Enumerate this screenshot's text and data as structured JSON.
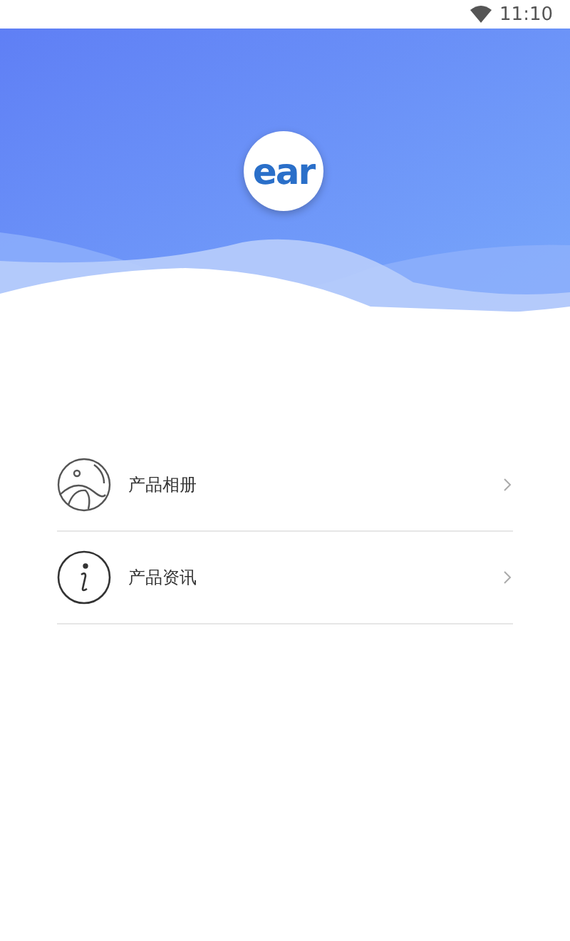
{
  "status_bar": {
    "time": "11:10"
  },
  "header": {
    "logo": "ear"
  },
  "menu": [
    {
      "kind": "album",
      "label": "产品相册"
    },
    {
      "kind": "info",
      "label": "产品资讯"
    }
  ]
}
